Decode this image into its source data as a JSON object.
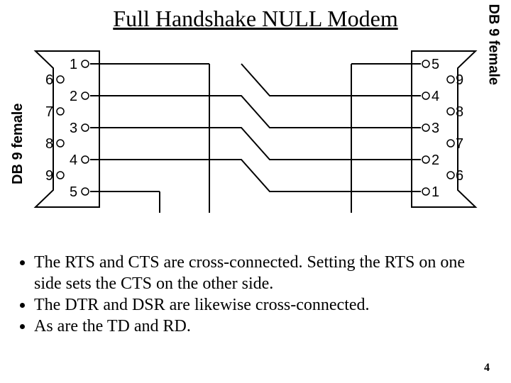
{
  "title": "Full Handshake NULL Modem",
  "left_connector_label": "DB 9 female",
  "right_connector_label": "DB 9 female",
  "left_pins_upper": [
    "1",
    "2",
    "3",
    "4",
    "5"
  ],
  "left_pins_lower": [
    "6",
    "7",
    "8",
    "9"
  ],
  "right_pins_upper": [
    "5",
    "4",
    "3",
    "2",
    "1"
  ],
  "right_pins_lower": [
    "9",
    "8",
    "7",
    "6"
  ],
  "bullets": [
    "The RTS and CTS are cross-connected. Setting the RTS on one side sets the CTS on the other side.",
    "The DTR and DSR are likewise cross-connected.",
    "As are the TD and RD."
  ],
  "page_number": "4"
}
